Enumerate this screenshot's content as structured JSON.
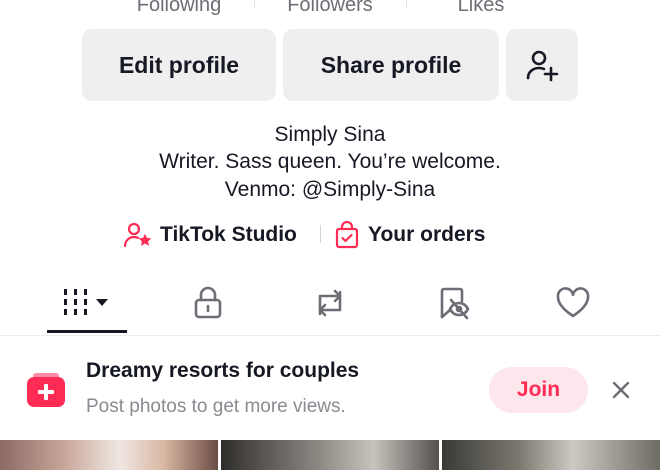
{
  "stats": {
    "following_label": "Following",
    "followers_label": "Followers",
    "likes_label": "Likes"
  },
  "actions": {
    "edit_profile": "Edit profile",
    "share_profile": "Share profile",
    "add_friend_icon": "person-plus-icon"
  },
  "bio": {
    "name": "Simply Sina",
    "line1": "Writer. Sass queen. You’re welcome.",
    "line2": "Venmo: @Simply-Sina"
  },
  "links": {
    "studio": "TikTok Studio",
    "orders": "Your orders",
    "accent_color": "#fe2c55"
  },
  "tabs": [
    {
      "name": "videos-grid",
      "icon": "grid-bars-icon",
      "active": true
    },
    {
      "name": "private",
      "icon": "lock-icon",
      "active": false
    },
    {
      "name": "reposts",
      "icon": "repost-icon",
      "active": false
    },
    {
      "name": "saved",
      "icon": "bookmark-eye-icon",
      "active": false
    },
    {
      "name": "liked",
      "icon": "heart-icon",
      "active": false
    }
  ],
  "promo": {
    "title": "Dreamy resorts for couples",
    "subtitle": "Post photos to get more views.",
    "join_label": "Join",
    "icon": "add-photos-icon"
  }
}
